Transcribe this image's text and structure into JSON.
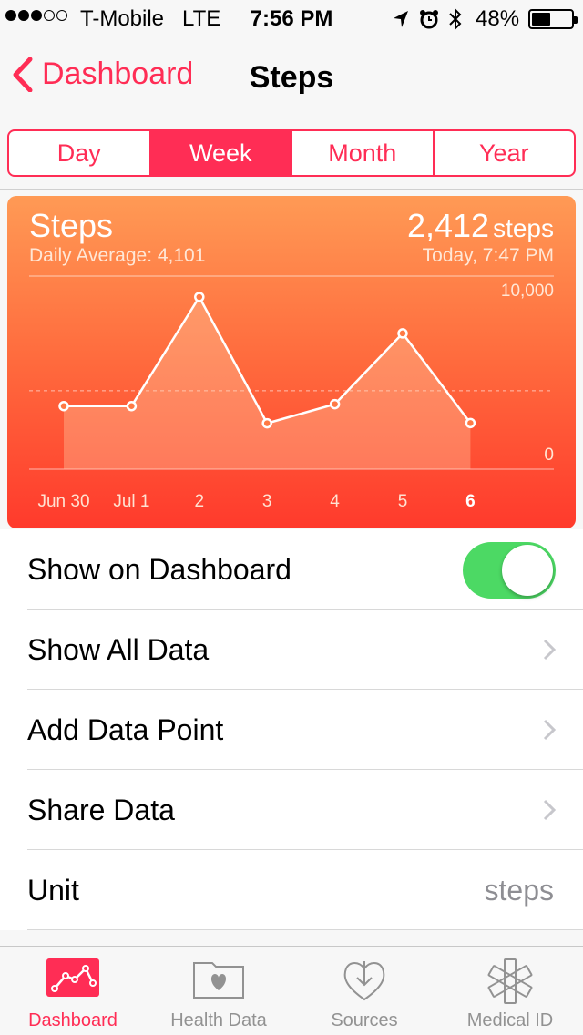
{
  "status_bar": {
    "carrier": "T-Mobile",
    "network": "LTE",
    "time": "7:56 PM",
    "battery_percent": "48%",
    "battery_level": 0.48,
    "signal_bars": 3,
    "signal_total": 5
  },
  "nav": {
    "back_label": "Dashboard",
    "title": "Steps"
  },
  "segments": {
    "items": [
      "Day",
      "Week",
      "Month",
      "Year"
    ],
    "selected": "Week"
  },
  "summary": {
    "title": "Steps",
    "daily_average": "Daily Average: 4,101",
    "value": "2,412",
    "unit": "steps",
    "timestamp": "Today, 7:47 PM"
  },
  "chart_data": {
    "type": "line",
    "categories": [
      "Jun 30",
      "Jul 1",
      "2",
      "3",
      "4",
      "5",
      "6"
    ],
    "values": [
      3300,
      3300,
      9000,
      2400,
      3400,
      7100,
      2412
    ],
    "ylim": [
      0,
      10000
    ],
    "y_tick_labels": [
      "10,000",
      "0"
    ],
    "average": 4101,
    "highlight_category": "6"
  },
  "settings": {
    "show_on_dashboard": "Show on Dashboard",
    "show_on_dashboard_on": true,
    "show_all_data": "Show All Data",
    "add_data_point": "Add Data Point",
    "share_data": "Share Data",
    "unit_label": "Unit",
    "unit_value": "steps"
  },
  "tabbar": {
    "items": [
      "Dashboard",
      "Health Data",
      "Sources",
      "Medical ID"
    ],
    "selected": "Dashboard"
  },
  "colors": {
    "accent": "#ff2d55",
    "toggle_on": "#4cd964",
    "card_top": "#ff9a55",
    "card_bottom": "#ff3a2c"
  }
}
